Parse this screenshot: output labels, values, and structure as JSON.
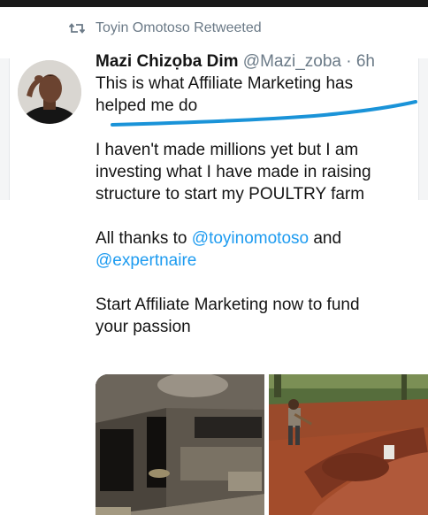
{
  "retweet": {
    "text": "Toyin Omotoso Retweeted",
    "icon": "retweet-icon"
  },
  "tweet": {
    "display_name": "Mazi Chizọba Dim",
    "handle": "@Mazi_zoba",
    "separator": "·",
    "time": "6h",
    "lines": {
      "p1_l1": "This is what Affiliate Marketing has",
      "p1_l2": "helped me do",
      "p2_l1": "I haven't made millions yet but I am",
      "p2_l2": "investing what I have made in raising",
      "p2_l3": "structure to start my POULTRY farm",
      "p3_pre": "All thanks to ",
      "p3_mention1": "@toyinomotoso",
      "p3_post": " and",
      "p3_mention2": "@expertnaire",
      "p4_l1": "Start Affiliate Marketing now to fund",
      "p4_l2": "your passion"
    }
  },
  "colors": {
    "mention": "#1d9bf0",
    "meta": "#6b7a87",
    "underline": "#1a93d8"
  },
  "media": {
    "photos": [
      "room-interior-photo",
      "farm-construction-photo"
    ]
  }
}
